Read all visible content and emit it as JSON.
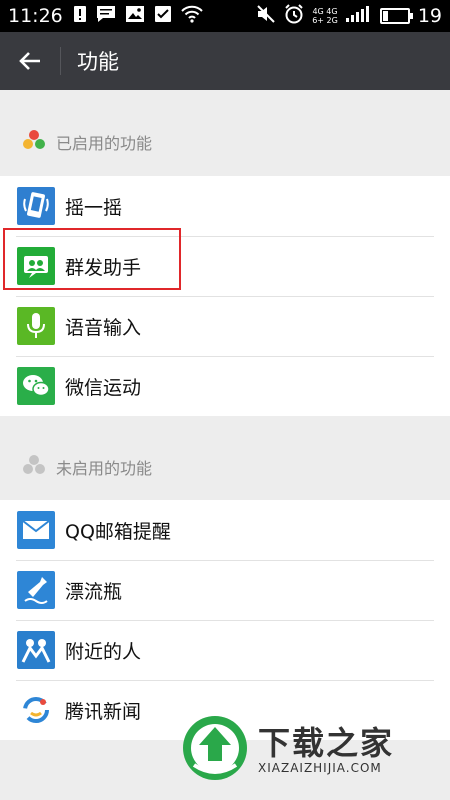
{
  "status_bar": {
    "time": "11:26",
    "net_top": "4G 4G",
    "net_bottom": "6+ 2G",
    "battery_level": 0.19,
    "battery_text": "19"
  },
  "app_bar": {
    "title": "功能"
  },
  "enabled": {
    "header": "已启用的功能",
    "items": [
      {
        "label": "摇一摇",
        "icon": "shake-icon",
        "color": "#2f7fd0"
      },
      {
        "label": "群发助手",
        "icon": "broadcast-assistant-icon",
        "color": "#22ac38"
      },
      {
        "label": "语音输入",
        "icon": "microphone-icon",
        "color": "#5ab825"
      },
      {
        "label": "微信运动",
        "icon": "wechat-sport-icon",
        "color": "#2aae49"
      }
    ]
  },
  "disabled": {
    "header": "未启用的功能",
    "items": [
      {
        "label": "QQ邮箱提醒",
        "icon": "mail-icon",
        "color": "#2e86d6"
      },
      {
        "label": "漂流瓶",
        "icon": "drift-bottle-icon",
        "color": "#2e86d6"
      },
      {
        "label": "附近的人",
        "icon": "people-nearby-icon",
        "color": "#2a7fcd"
      },
      {
        "label": "腾讯新闻",
        "icon": "tencent-news-icon",
        "color": "#ffffff"
      }
    ]
  },
  "watermark": {
    "brand": "下载之家",
    "url": "XIAZAIZHIJIA.COM"
  }
}
